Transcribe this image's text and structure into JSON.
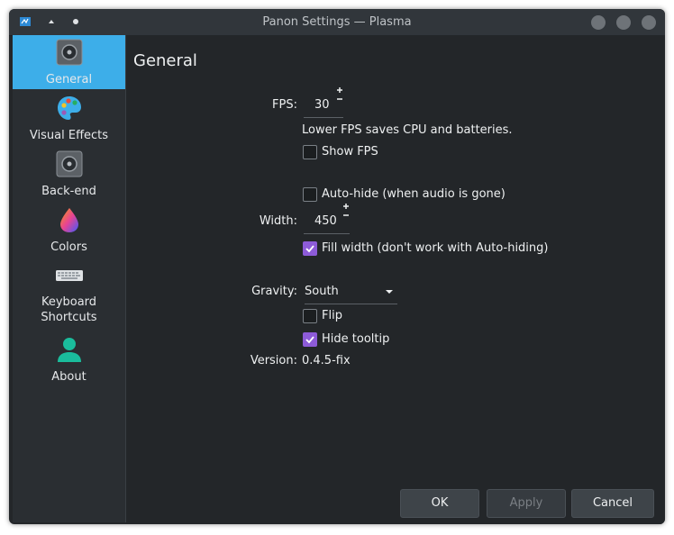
{
  "window": {
    "title": "Panon Settings — Plasma"
  },
  "sidebar": {
    "items": [
      {
        "label": "General",
        "icon": "speaker-icon",
        "active": true
      },
      {
        "label": "Visual Effects",
        "icon": "palette-icon",
        "active": false
      },
      {
        "label": "Back-end",
        "icon": "speaker-icon",
        "active": false
      },
      {
        "label": "Colors",
        "icon": "color-drop-icon",
        "active": false
      },
      {
        "label": "Keyboard Shortcuts",
        "icon": "keyboard-icon",
        "active": false
      },
      {
        "label": "About",
        "icon": "user-icon",
        "active": false
      }
    ]
  },
  "general": {
    "title": "General",
    "fps_label": "FPS:",
    "fps_value": "30",
    "fps_hint": "Lower FPS saves CPU and batteries.",
    "show_fps_label": "Show FPS",
    "show_fps_checked": false,
    "autohide_label": "Auto-hide (when audio is gone)",
    "autohide_checked": false,
    "width_label": "Width:",
    "width_value": "450",
    "fill_width_label": "Fill width (don't work with Auto-hiding)",
    "fill_width_checked": true,
    "gravity_label": "Gravity:",
    "gravity_value": "South",
    "flip_label": "Flip",
    "flip_checked": false,
    "hide_tooltip_label": "Hide tooltip",
    "hide_tooltip_checked": true,
    "version_label": "Version:",
    "version_value": "0.4.5-fix"
  },
  "buttons": {
    "ok": "OK",
    "apply": "Apply",
    "cancel": "Cancel"
  },
  "colors": {
    "accent": "#3daee9",
    "checkbox_checked": "#8d5bd8",
    "background": "#232629"
  }
}
